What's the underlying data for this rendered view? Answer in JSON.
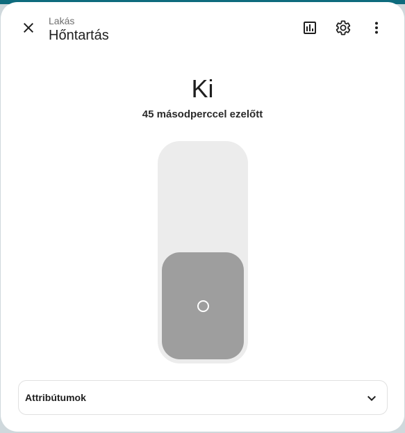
{
  "header": {
    "area": "Lakás",
    "entity_name": "Hőntartás",
    "close_icon": "close-icon",
    "history_icon": "chart-icon",
    "settings_icon": "gear-icon",
    "more_icon": "dots-vertical-icon"
  },
  "state": {
    "value": "Ki",
    "last_changed": "45 másodperccel ezelőtt",
    "toggle_on": false
  },
  "attributes": {
    "label": "Attribútumok",
    "icon": "chevron-down-icon"
  },
  "colors": {
    "thumb_off": "#9e9e9e",
    "track": "#ececec"
  }
}
